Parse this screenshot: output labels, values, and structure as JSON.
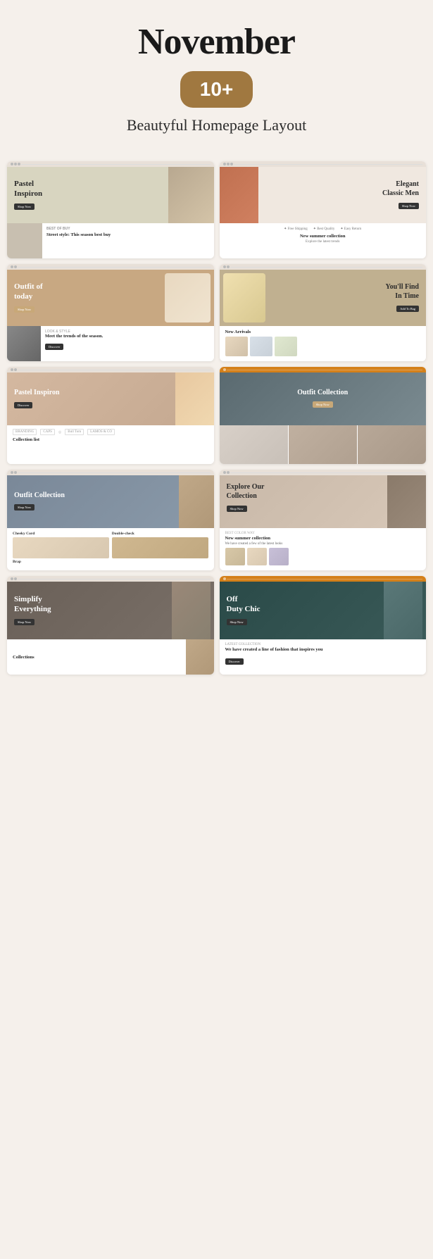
{
  "header": {
    "title": "November",
    "badge": "10+",
    "subtitle": "Beautyful Homepage Layout"
  },
  "cards": [
    {
      "id": "card-1",
      "hero_text": "Pastel\nInspiron",
      "sub_title": "Street style: This season best buy",
      "theme": "pastel"
    },
    {
      "id": "card-2",
      "hero_text": "Elegant\nClassic Men",
      "sub_title": "New summer collection",
      "theme": "elegant"
    },
    {
      "id": "card-3",
      "hero_text": "Outfit of\ntoday",
      "sub_title": "Meet the trends of the season.",
      "theme": "outfit"
    },
    {
      "id": "card-4",
      "hero_text": "You'll Find\nIn Time",
      "sub_title": "New Arrivals",
      "theme": "find"
    },
    {
      "id": "card-5",
      "hero_text": "Pastel Inspiron",
      "sub_title": "Collection list",
      "theme": "pastel2"
    },
    {
      "id": "card-6",
      "hero_text": "Outfit Collection",
      "sub_title": "",
      "theme": "outfit-collection"
    },
    {
      "id": "card-7",
      "hero_text": "Outfit Collection",
      "sub_title": "Cheeky Cord\nDouble-check\nBrap",
      "theme": "outfit-collection2"
    },
    {
      "id": "card-8",
      "hero_text": "Explore Our\nCollection",
      "sub_title": "New summer collection",
      "theme": "explore"
    },
    {
      "id": "card-9",
      "hero_text": "Simplify\nEverything",
      "sub_title": "Collections",
      "theme": "simplify"
    },
    {
      "id": "card-10",
      "hero_text": "Off\nDuty Chic",
      "sub_title": "We have created a line of fashion that inspires you",
      "theme": "offduty"
    }
  ]
}
